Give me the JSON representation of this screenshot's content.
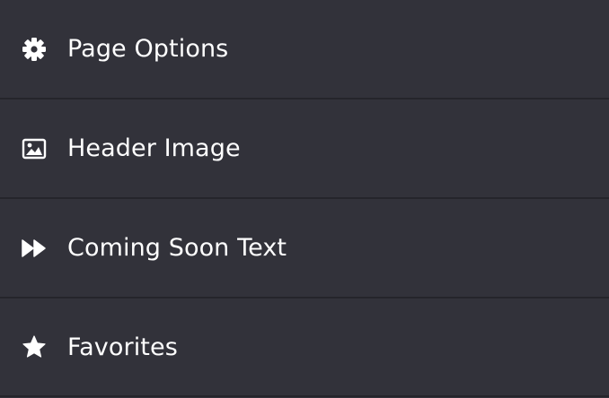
{
  "menu": {
    "items": [
      {
        "label": "Page Options",
        "icon": "gear-icon"
      },
      {
        "label": "Header Image",
        "icon": "image-icon"
      },
      {
        "label": "Coming Soon Text",
        "icon": "fast-forward-icon"
      },
      {
        "label": "Favorites",
        "icon": "star-icon"
      }
    ]
  },
  "colors": {
    "background": "#32323a",
    "divider": "#25252b",
    "text": "#ffffff"
  }
}
